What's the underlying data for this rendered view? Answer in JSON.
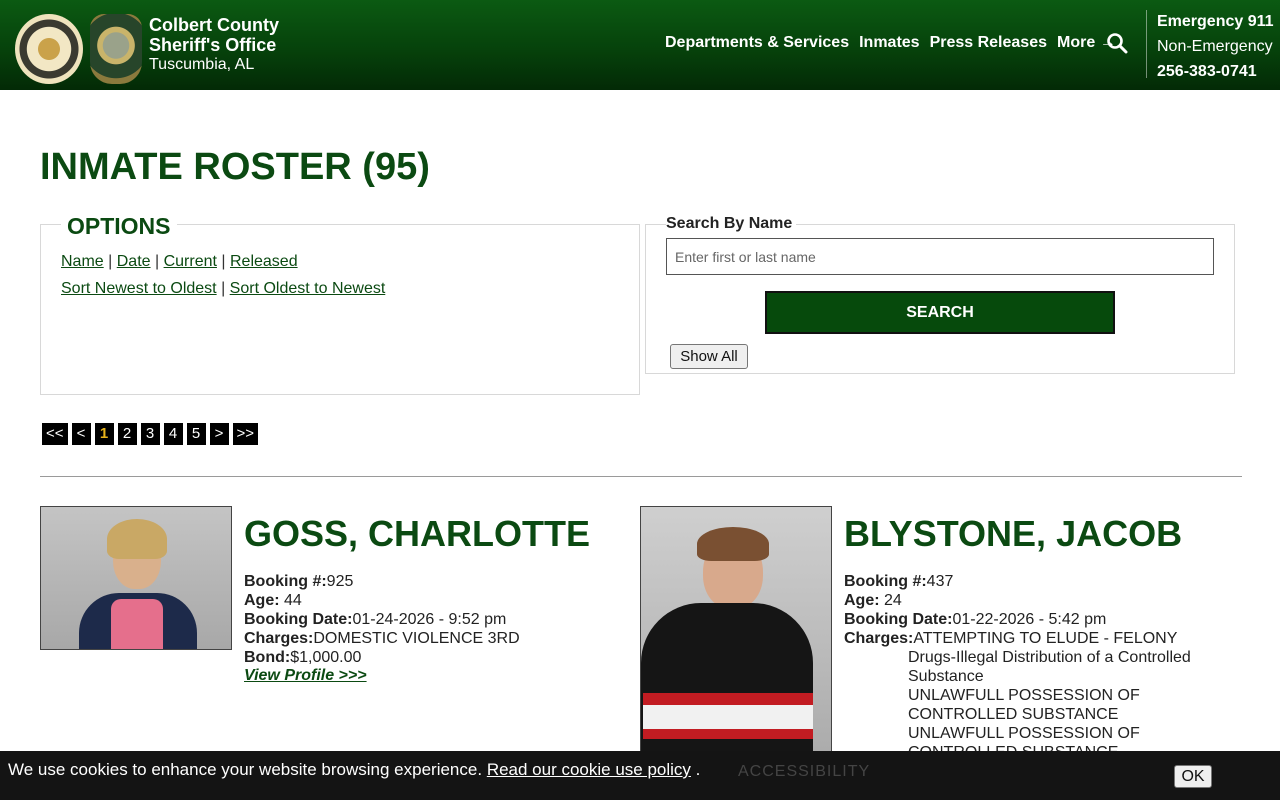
{
  "header": {
    "brand_line1": "Colbert County",
    "brand_line2": "Sheriff's Office",
    "location": "Tuscumbia, AL",
    "nav": [
      "Departments & Services",
      "Inmates",
      "Press Releases",
      "More"
    ],
    "more_arrow": "→",
    "emergency_label": "Emergency 911",
    "non_emergency_label": "Non-Emergency",
    "non_emergency_phone": "256-383-0741"
  },
  "page": {
    "title": "INMATE ROSTER (95)"
  },
  "options": {
    "legend": "OPTIONS",
    "sort_by": [
      "Name",
      "Date",
      "Current",
      "Released"
    ],
    "order": [
      "Sort Newest to Oldest",
      "Sort Oldest to Newest"
    ],
    "separator": " | "
  },
  "search": {
    "label": "Search By Name",
    "placeholder": "Enter first or last name",
    "button": "SEARCH",
    "show_all": "Show All"
  },
  "pagination": {
    "items": [
      "<<",
      "<",
      "1",
      "2",
      "3",
      "4",
      "5",
      ">",
      ">>"
    ],
    "current": "1"
  },
  "inmates": [
    {
      "name": "GOSS, CHARLOTTE",
      "booking_label": "Booking #:",
      "booking": "925",
      "age_label": "Age:",
      "age": " 44",
      "date_label": "Booking Date:",
      "date": "01-24-2026 - 9:52 pm",
      "charges_label": "Charges:",
      "charges": [
        "DOMESTIC VIOLENCE 3RD"
      ],
      "bond_label": "Bond:",
      "bond": "$1,000.00",
      "profile_link": "View Profile >>>"
    },
    {
      "name": "BLYSTONE, JACOB",
      "booking_label": "Booking #:",
      "booking": "437",
      "age_label": "Age:",
      "age": " 24",
      "date_label": "Booking Date:",
      "date": "01-22-2026 - 5:42 pm",
      "charges_label": "Charges:",
      "charges": [
        "ATTEMPTING TO ELUDE - FELONY",
        "Drugs-Illegal Distribution of a Controlled Substance",
        "UNLAWFULL POSSESSION OF CONTROLLED SUBSTANCE",
        "UNLAWFULL POSSESSION OF CONTROLLED SUBSTANCE"
      ]
    }
  ],
  "cookie": {
    "text": "We use cookies to enhance your website browsing experience.",
    "link": "Read our cookie use policy",
    "after": " .",
    "ok": "OK",
    "behind_text": "ACCESSIBILITY"
  },
  "colors": {
    "brand_green": "#0b4a12",
    "header_green": "#06420b",
    "pager_active": "#e8b31b"
  },
  "icons": [
    "county-seal-logo",
    "sheriff-badge-logo",
    "search-icon",
    "arrow-right-icon"
  ]
}
